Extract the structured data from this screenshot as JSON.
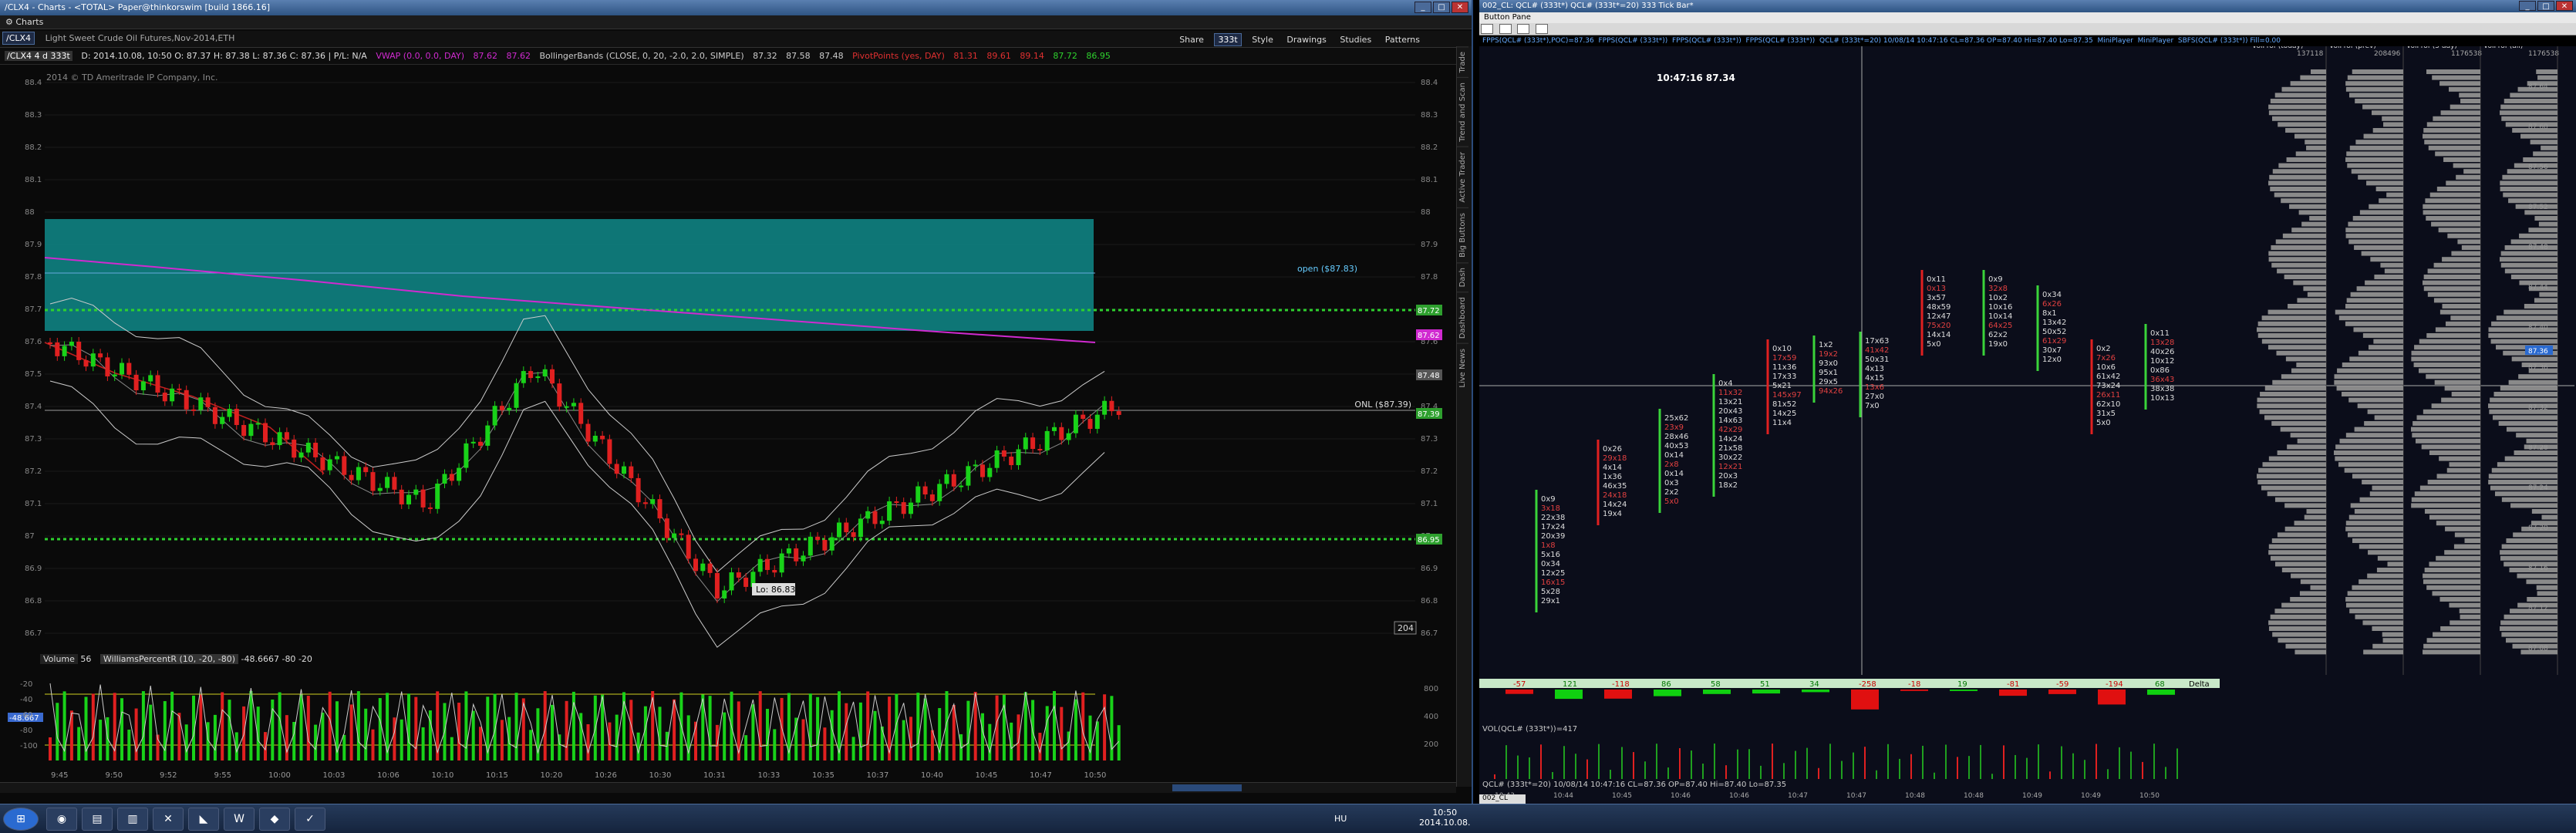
{
  "left_window": {
    "title": "/CLX4 - Charts - <TOTAL> Paper@thinkorswim [build 1866.16]",
    "menu_label": "Charts",
    "symbol": "/CLX4",
    "instrument_desc": "Light Sweet Crude Oil Futures,Nov-2014,ETH",
    "toolbar_right": [
      "Share",
      "Style",
      "Drawings",
      "Studies",
      "Patterns"
    ],
    "zoom_label": "333t",
    "study_line": {
      "sym_period": "/CLX4 4 d 333t",
      "ohlc": "D: 2014.10.08, 10:50  O: 87.37  H: 87.38  L: 87.36  C: 87.36  |  P/L: N/A",
      "vwap": "VWAP (0.0, 0.0, DAY)",
      "vwap_vals": [
        "87.62",
        "87.62"
      ],
      "bb": "BollingerBands (CLOSE, 0, 20, -2.0, 2.0, SIMPLE)",
      "bb_vals": [
        "87.32",
        "87.58",
        "87.48"
      ],
      "pivot": "PivotPoints (yes, DAY)",
      "pivot_vals": [
        "81.31",
        "89.61",
        "89.14",
        "87.72",
        "86.95"
      ]
    },
    "copyright": "2014 © TD Ameritrade IP Company, Inc.",
    "price_axis": [
      "88.4",
      "88.3",
      "88.2",
      "88.1",
      "88",
      "87.9",
      "87.8",
      "87.7",
      "87.6",
      "87.5",
      "87.4",
      "87.3",
      "87.2",
      "87.1",
      "87",
      "86.9",
      "86.8",
      "86.7"
    ],
    "price_badges": [
      {
        "text": "87.72",
        "color": "#2ea02e"
      },
      {
        "text": "87.62",
        "color": "#d02ad0"
      },
      {
        "text": "87.48",
        "color": "#555555"
      },
      {
        "text": "87.39",
        "color": "#2ea02e"
      },
      {
        "text": "86.95",
        "color": "#2ea02e"
      }
    ],
    "annotations": {
      "open_label": "open ($87.83)",
      "onl_label": "ONL ($87.39)",
      "low_label": "Lo: 86.83",
      "tick_count": "204"
    },
    "lower_pane": {
      "volume_label": "Volume",
      "volume_val": "56",
      "williams_label": "WilliamsPercentR (10, -20, -80)",
      "williams_vals": [
        "-48.6667",
        "-80",
        "-20"
      ],
      "badge": "-48.667",
      "axis": [
        "-20",
        "-40",
        "-60",
        "-80",
        "-100"
      ],
      "vol_axis": [
        "800",
        "400",
        "200"
      ]
    },
    "time_axis": [
      "9:45",
      "9:50",
      "9:52",
      "9:55",
      "10:00",
      "10:03",
      "10:06",
      "10:10",
      "10:15",
      "10:20",
      "10:26",
      "10:30",
      "10:31",
      "10:33",
      "10:35",
      "10:37",
      "10:40",
      "10:45",
      "10:47",
      "10:50"
    ],
    "side_tabs": [
      "Trade",
      "Trend and Scan",
      "Active Trader",
      "Big Buttons",
      "Dash",
      "Dashboard",
      "Live News"
    ],
    "colors": {
      "bull": "#19d219",
      "bear": "#e02020",
      "zone": "#0f8a8a",
      "pivot_line": "#2ed22e"
    }
  },
  "right_window": {
    "title": "002_CL: QCL# (333t*) QCL# (333t*=20) 333 Tick Bar*",
    "button_pane": "Button Pane",
    "header_tabs": [
      "FPPS(QCL# (333t*),POC)=87.36",
      "FPPS(QCL# (333t*))",
      "FPPS(QCL# (333t*))",
      "FPPS(QCL# (333t*))",
      "QCL# (333t*=20) 10/08/14 10:47:16 CL=87.36 OP=87.40 Hi=87.40 Lo=87.35",
      "MiniPlayer",
      "MiniPlayer",
      "SBFS(QCL# (333t*)) Fill=0.00"
    ],
    "crosshair_label": "10:47:16  87.34",
    "vol_profile_headers": [
      {
        "label": "VolProf (today)",
        "val": "137118"
      },
      {
        "label": "VolProf (prev)",
        "val": "208496"
      },
      {
        "label": "VolProf (5 day)",
        "val": "1176538"
      },
      {
        "label": "VolProf (all)",
        "val": "1176538"
      }
    ],
    "price_axis": [
      "87.64",
      "87.60",
      "87.56",
      "87.52",
      "87.48",
      "87.44",
      "87.40",
      "87.36",
      "87.32",
      "87.28",
      "87.24",
      "87.20",
      "87.16",
      "87.12",
      "87.08"
    ],
    "price_highlight": "87.36",
    "delta_values": [
      "-57",
      "121",
      "-118",
      "86",
      "58",
      "51",
      "34",
      "-258",
      "-18",
      "19",
      "-81",
      "-59",
      "-194",
      "68"
    ],
    "delta_label": "Delta",
    "vol_pane_label": "VOL(QCL# (333t*))=417",
    "bottom_info": "QCL# (333t*=20) 10/08/14 10:47:16 CL=87.36 OP=87.40 Hi=87.40 Lo=87.35",
    "time_axis": [
      "10:43",
      "10:44",
      "10:45",
      "10:46",
      "10:46",
      "10:47",
      "10:47",
      "10:48",
      "10:48",
      "10:49",
      "10:49",
      "10:50"
    ],
    "bottom_tab": "002_CL",
    "footprint_sample": [
      [
        "0x9",
        "3x18",
        "22x38",
        "17x24",
        "20x39",
        "1x8",
        "5x16",
        "0x34",
        "12x25",
        "16x15",
        "5x28",
        "29x1"
      ],
      [
        "0x26",
        "29x18",
        "4x14",
        "1x36",
        "46x35",
        "24x18",
        "14x24",
        "19x4"
      ],
      [
        "25x62",
        "23x9",
        "28x46",
        "40x53",
        "0x14",
        "2x8",
        "0x14",
        "0x3",
        "2x2",
        "5x0"
      ],
      [
        "0x4",
        "11x32",
        "13x21",
        "20x43",
        "14x63",
        "42x29",
        "14x24",
        "21x58",
        "30x22",
        "12x21",
        "20x3",
        "18x2"
      ],
      [
        "0x10",
        "17x59",
        "11x36",
        "17x33",
        "5x21",
        "145x97",
        "81x52",
        "14x25",
        "11x4"
      ],
      [
        "1x2",
        "19x2",
        "93x0",
        "95x1",
        "29x5",
        "94x26"
      ],
      [
        "17x63",
        "41x42",
        "50x31",
        "4x13",
        "4x15",
        "13x6",
        "27x0",
        "7x0"
      ],
      [
        "0x11",
        "0x13",
        "3x57",
        "48x59",
        "12x47",
        "75x20",
        "14x14",
        "5x0"
      ],
      [
        "0x9",
        "32x8",
        "10x2",
        "10x16",
        "10x14",
        "64x25",
        "62x2",
        "19x0"
      ],
      [
        "0x34",
        "6x26",
        "8x1",
        "13x42",
        "50x52",
        "61x29",
        "30x7",
        "12x0"
      ],
      [
        "0x2",
        "7x26",
        "10x6",
        "61x42",
        "73x24",
        "26x11",
        "62x10",
        "31x5",
        "5x0"
      ],
      [
        "0x11",
        "13x28",
        "40x26",
        "10x12",
        "0x86",
        "36x43",
        "38x38",
        "10x13"
      ]
    ]
  },
  "taskbar": {
    "lang": "HU",
    "time": "10:50",
    "date": "2014.10.08."
  }
}
